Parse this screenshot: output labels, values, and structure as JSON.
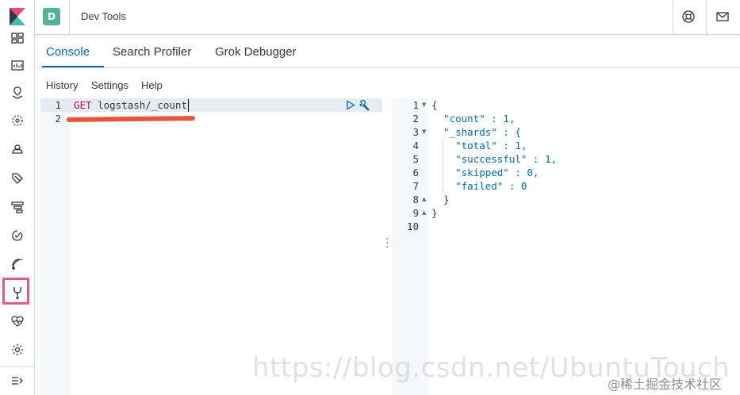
{
  "header": {
    "space_initial": "D",
    "app_title": "Dev Tools"
  },
  "tabs": [
    {
      "label": "Console",
      "active": true
    },
    {
      "label": "Search Profiler",
      "active": false
    },
    {
      "label": "Grok Debugger",
      "active": false
    }
  ],
  "menu": {
    "history": "History",
    "settings": "Settings",
    "help": "Help"
  },
  "request": {
    "line_numbers": [
      "1",
      "2"
    ],
    "method": "GET",
    "path": " logstash/_count"
  },
  "response": {
    "line_numbers": [
      "1",
      "2",
      "3",
      "4",
      "5",
      "6",
      "7",
      "8",
      "9",
      "10"
    ],
    "lines": [
      "{",
      "  \"count\" : 1,",
      "  \"_shards\" : {",
      "    \"total\" : 1,",
      "    \"successful\" : 1,",
      "    \"skipped\" : 0,",
      "    \"failed\" : 0",
      "  }",
      "}",
      ""
    ]
  },
  "colors": {
    "accent": "#006bb4",
    "highlight_box": "#e25a8a",
    "annotation_underline": "#e8553b",
    "space_badge": "#54b399"
  },
  "icons": {
    "nav": [
      "kibana-logo-icon",
      "dashboard-icon",
      "canvas-icon",
      "maps-icon",
      "ml-icon",
      "metrics-icon",
      "logs-icon",
      "apm-icon",
      "uptime-icon",
      "siem-icon",
      "dev-tools-icon",
      "stack-monitoring-icon",
      "management-icon",
      "collapse-nav-icon"
    ],
    "header": [
      "help-icon",
      "mail-icon"
    ]
  },
  "watermark": {
    "url": "https://blog.csdn.net/UbuntuTouch",
    "site": "@稀土掘金技术社区"
  }
}
